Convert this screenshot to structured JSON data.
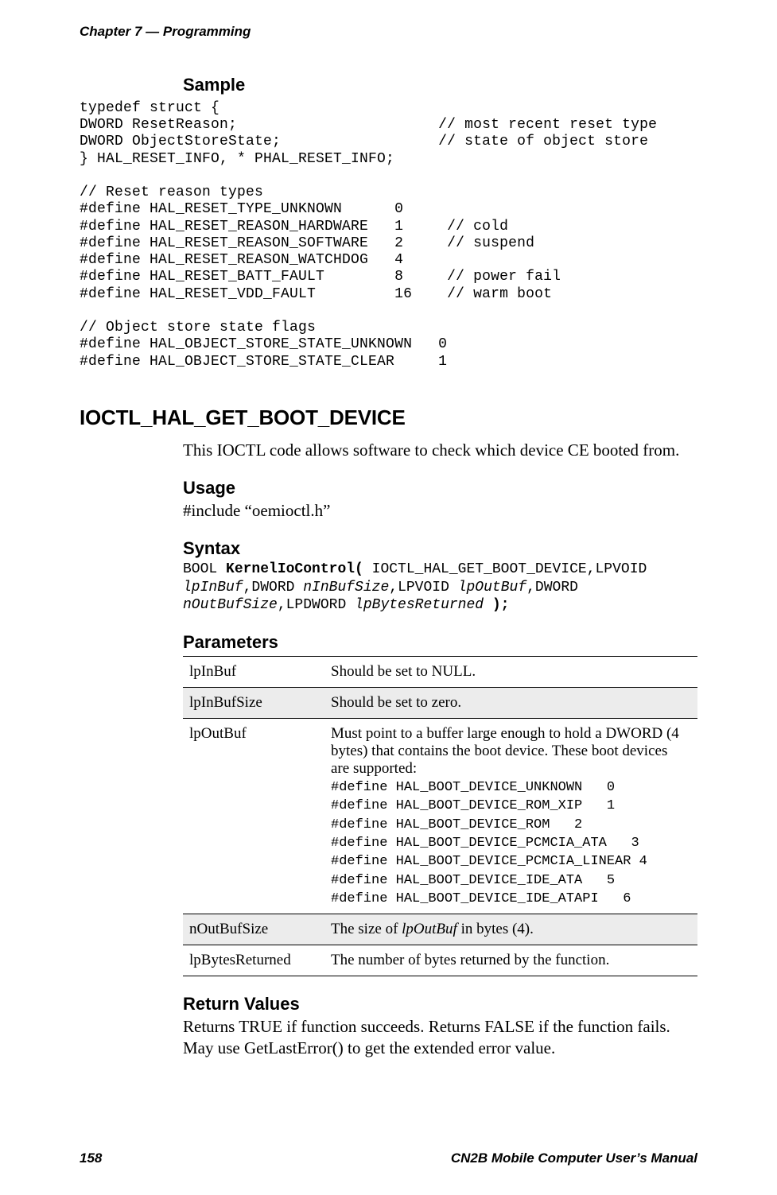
{
  "running_head": "Chapter 7 — Programming",
  "sample": {
    "heading": "Sample",
    "code": "typedef struct {\nDWORD ResetReason;                       // most recent reset type\nDWORD ObjectStoreState;                  // state of object store\n} HAL_RESET_INFO, * PHAL_RESET_INFO;\n\n// Reset reason types\n#define HAL_RESET_TYPE_UNKNOWN      0\n#define HAL_RESET_REASON_HARDWARE   1     // cold\n#define HAL_RESET_REASON_SOFTWARE   2     // suspend\n#define HAL_RESET_REASON_WATCHDOG   4\n#define HAL_RESET_BATT_FAULT        8     // power fail\n#define HAL_RESET_VDD_FAULT         16    // warm boot\n\n// Object store state flags\n#define HAL_OBJECT_STORE_STATE_UNKNOWN   0\n#define HAL_OBJECT_STORE_STATE_CLEAR     1"
  },
  "section_title": "IOCTL_HAL_GET_BOOT_DEVICE",
  "intro": "This IOCTL code allows software to check which device CE booted from.",
  "usage": {
    "heading": "Usage",
    "text": "#include “oemioctl.h”"
  },
  "syntax": {
    "heading": "Syntax",
    "pieces": {
      "p1": "BOOL ",
      "fn": "KernelIoControl(",
      "p2": " IOCTL_HAL_GET_BOOT_DEVICE,LPVOID ",
      "a1": "lpInBuf",
      "p3": ",DWORD ",
      "a2": "nInBufSize",
      "p4": ",LPVOID ",
      "a3": "lpOutBuf",
      "p5": ",DWORD ",
      "a4": "nOutBufSize",
      "p6": ",LPDWORD ",
      "a5": "lpBytesReturned",
      "close": " );"
    }
  },
  "parameters": {
    "heading": "Parameters",
    "rows": [
      {
        "name": "lpInBuf",
        "desc": "Should be set to NULL."
      },
      {
        "name": "lpInBufSize",
        "desc": "Should be set to zero."
      },
      {
        "name": "lpOutBuf",
        "desc_intro": "Must point to a buffer large enough to hold a DWORD (4 bytes) that contains the boot device. These boot devices are supported:",
        "code": "#define HAL_BOOT_DEVICE_UNKNOWN   0\n#define HAL_BOOT_DEVICE_ROM_XIP   1\n#define HAL_BOOT_DEVICE_ROM   2\n#define HAL_BOOT_DEVICE_PCMCIA_ATA   3\n#define HAL_BOOT_DEVICE_PCMCIA_LINEAR 4\n#define HAL_BOOT_DEVICE_IDE_ATA   5\n#define HAL_BOOT_DEVICE_IDE_ATAPI   6"
      },
      {
        "name": "nOutBufSize",
        "desc_prefix": "The size of ",
        "desc_ital": "lpOutBuf",
        "desc_suffix": " in bytes (4)."
      },
      {
        "name": "lpBytesReturned",
        "desc": "The number of bytes returned by the function."
      }
    ]
  },
  "return_values": {
    "heading": "Return Values",
    "text": "Returns TRUE if function succeeds. Returns FALSE if the function fails. May use GetLastError() to get the extended error value."
  },
  "footer": {
    "page": "158",
    "manual": "CN2B Mobile Computer User’s Manual"
  }
}
